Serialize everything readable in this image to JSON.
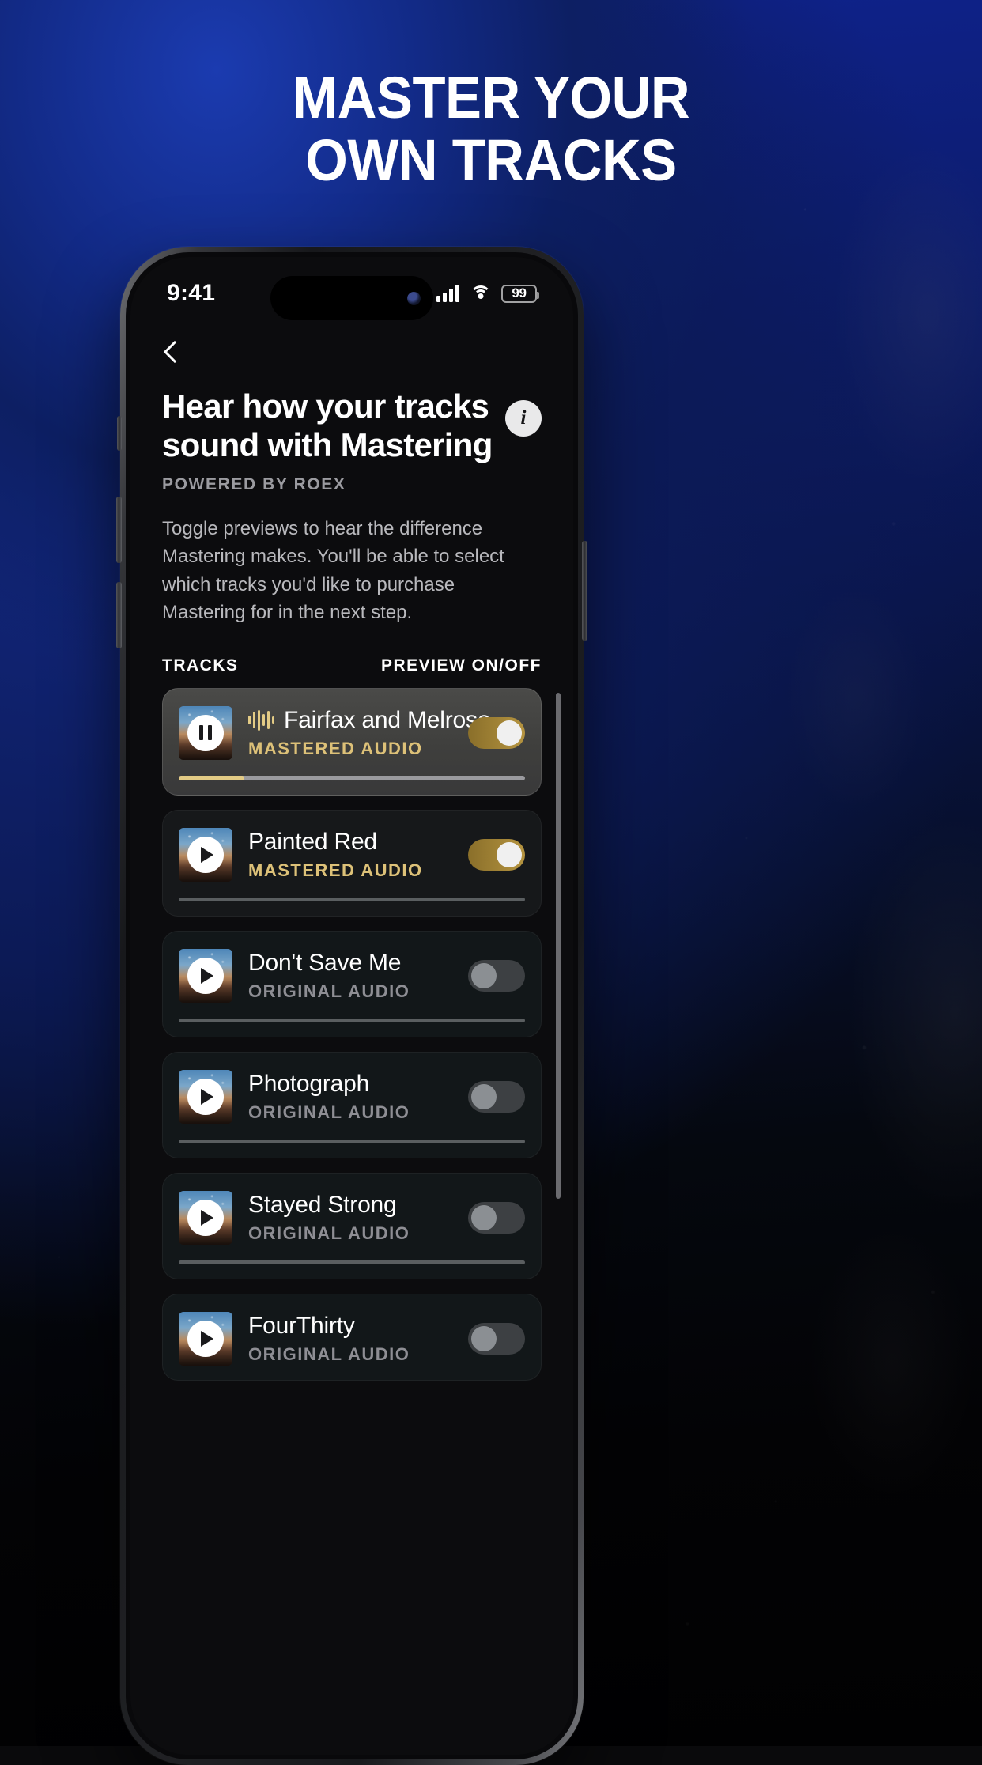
{
  "poster": {
    "headline_line1": "MASTER YOUR",
    "headline_line2": "OWN TRACKS",
    "bg_color": "#0d1f63",
    "accent_gold": "#ddc178"
  },
  "status_bar": {
    "time": "9:41",
    "signal_icon": "cellular-signal-icon",
    "wifi_icon": "wifi-icon",
    "battery_level": "99"
  },
  "nav": {
    "back_icon": "chevron-left-icon"
  },
  "header": {
    "title": "Hear how your tracks sound with Mastering",
    "info_icon": "info-icon",
    "info_label": "i",
    "powered_by": "POWERED BY ROEX",
    "description": "Toggle previews to hear the difference Mastering makes. You'll be able to select which tracks you'd like to purchase Mastering for in the next step."
  },
  "list_header": {
    "left": "TRACKS",
    "right": "PREVIEW ON/OFF"
  },
  "tracks": [
    {
      "title": "Fairfax and Melrose",
      "subtitle": "MASTERED AUDIO",
      "state": "mastered",
      "toggle": "on",
      "playing": true,
      "play_icon": "pause-icon",
      "waveform_icon": "waveform-icon",
      "toggle_icon": "toggle-switch-on",
      "progress_percent": 19,
      "artwork_icon": "album-artwork"
    },
    {
      "title": "Painted Red",
      "subtitle": "MASTERED AUDIO",
      "state": "mastered",
      "toggle": "on",
      "playing": false,
      "play_icon": "play-icon",
      "toggle_icon": "toggle-switch-on",
      "progress_percent": 0,
      "artwork_icon": "album-artwork"
    },
    {
      "title": "Don't Save Me",
      "subtitle": "ORIGINAL AUDIO",
      "state": "original",
      "toggle": "off",
      "playing": false,
      "play_icon": "play-icon",
      "toggle_icon": "toggle-switch-off",
      "progress_percent": 0,
      "artwork_icon": "album-artwork"
    },
    {
      "title": "Photograph",
      "subtitle": "ORIGINAL AUDIO",
      "state": "original",
      "toggle": "off",
      "playing": false,
      "play_icon": "play-icon",
      "toggle_icon": "toggle-switch-off",
      "progress_percent": 0,
      "artwork_icon": "album-artwork"
    },
    {
      "title": "Stayed Strong",
      "subtitle": "ORIGINAL AUDIO",
      "state": "original",
      "toggle": "off",
      "playing": false,
      "play_icon": "play-icon",
      "toggle_icon": "toggle-switch-off",
      "progress_percent": 0,
      "artwork_icon": "album-artwork"
    },
    {
      "title": "FourThirty",
      "subtitle": "ORIGINAL AUDIO",
      "state": "original",
      "toggle": "off",
      "playing": false,
      "play_icon": "play-icon",
      "toggle_icon": "toggle-switch-off",
      "progress_percent": 0,
      "artwork_icon": "album-artwork"
    }
  ]
}
